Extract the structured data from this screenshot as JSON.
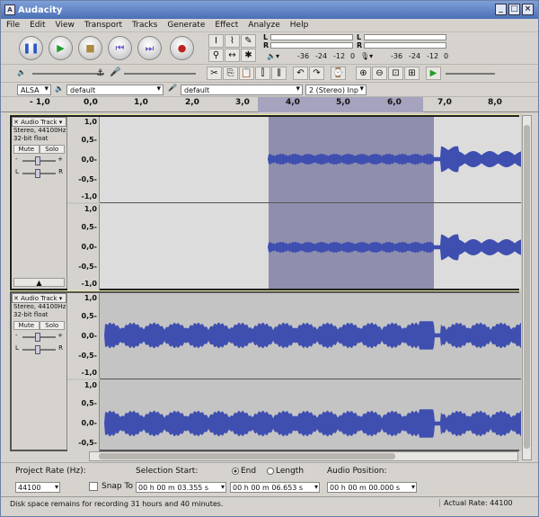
{
  "window": {
    "title": "Audacity"
  },
  "menu": [
    "File",
    "Edit",
    "View",
    "Transport",
    "Tracks",
    "Generate",
    "Effect",
    "Analyze",
    "Help"
  ],
  "meters": {
    "left": "L",
    "right": "R",
    "db": [
      "-36",
      "-24",
      "-12",
      "0"
    ]
  },
  "devices": {
    "host": "ALSA",
    "playback": "default",
    "recording": "default",
    "channels": "2 (Stereo) Inp"
  },
  "ruler": [
    "- 1,0",
    "0,0",
    "1,0",
    "2,0",
    "3,0",
    "4,0",
    "5,0",
    "6,0",
    "7,0",
    "8,0"
  ],
  "tracks": [
    {
      "name": "Audio Track",
      "rate": "Stereo, 44100Hz",
      "format": "32-bit float",
      "mute": "Mute",
      "solo": "Solo",
      "scale": [
        "1,0",
        "0,5-",
        "0,0-",
        "-0,5-",
        "-1,0"
      ]
    },
    {
      "name": "Audio Track",
      "rate": "Stereo, 44100Hz",
      "format": "32-bit float",
      "mute": "Mute",
      "solo": "Solo",
      "scale": [
        "1,0",
        "0,5-",
        "0,0-",
        "-0,5-",
        "-1,0"
      ]
    }
  ],
  "slider_marks": {
    "minus": "-",
    "plus": "+",
    "l": "L",
    "r": "R"
  },
  "selection": {
    "rate_label": "Project Rate (Hz):",
    "rate": "44100",
    "snap": "Snap To",
    "start_label": "Selection Start:",
    "end": "End",
    "length": "Length",
    "start": "00 h 00 m 03.355 s",
    "endval": "00 h 00 m 06.653 s",
    "pos_label": "Audio Position:",
    "pos": "00 h 00 m 00.000 s"
  },
  "status": {
    "left": "Disk space remains for recording 31 hours and 40 minutes.",
    "right": "Actual Rate: 44100"
  },
  "colors": {
    "wave": "#3f4fb0",
    "selection": "#8e8eae",
    "title": "#4a6fb5"
  }
}
